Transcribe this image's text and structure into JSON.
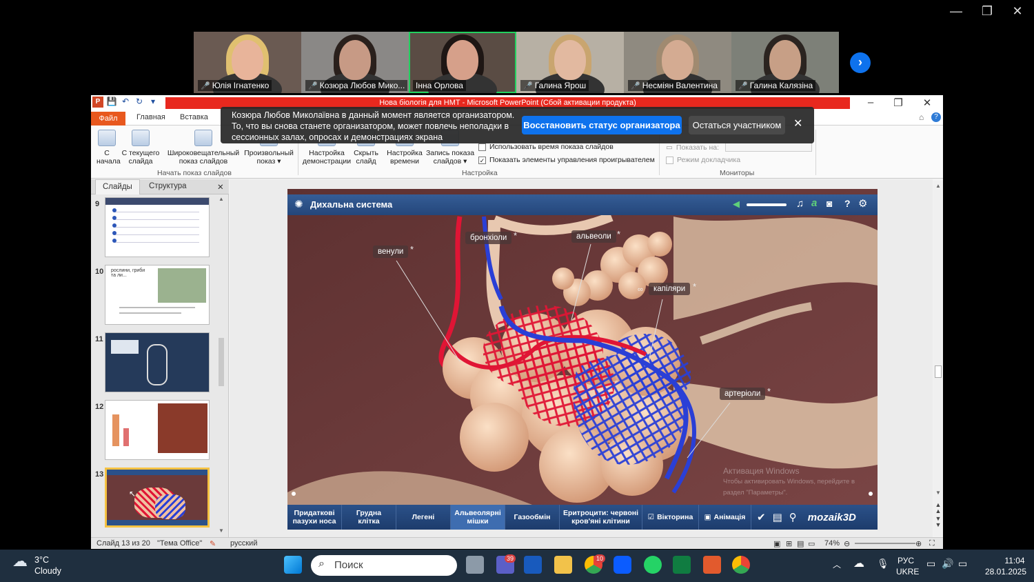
{
  "window": {
    "minimize": "—",
    "restore": "❐",
    "close": "✕"
  },
  "gallery": {
    "participants": [
      {
        "name": "Юлія Ігнатенко",
        "muted": true,
        "active": false,
        "bg": "#6a5a52",
        "face": "#e8b49a",
        "hair": "#e0c070"
      },
      {
        "name": "Козюра Любов Мико...",
        "muted": true,
        "active": false,
        "bg": "#8a8886",
        "face": "#c79a85",
        "hair": "#2a201c"
      },
      {
        "name": "Інна Орлова",
        "muted": false,
        "active": true,
        "bg": "#5a4c44",
        "face": "#d6a08a",
        "hair": "#1e1614"
      },
      {
        "name": "Галина Ярош",
        "muted": true,
        "active": false,
        "bg": "#b7b0a4",
        "face": "#e2b9a0",
        "hair": "#c9a56f"
      },
      {
        "name": "Несміян Валентина",
        "muted": true,
        "active": false,
        "bg": "#8f8a80",
        "face": "#d4ab92",
        "hair": "#a08a70"
      },
      {
        "name": "Галина Калязіна",
        "muted": true,
        "active": false,
        "bg": "#7d8078",
        "face": "#c79f86",
        "hair": "#2b2420"
      }
    ],
    "next_icon": "chevron-right-icon"
  },
  "ppt": {
    "title": "Нова біологія для НМТ - Microsoft PowerPoint (Сбой активации продукта)",
    "tabs": {
      "file": "Файл",
      "home": "Главная",
      "insert": "Вставка"
    },
    "ribbon": {
      "from_start": "С\nначала",
      "from_current": "С текущего\nслайда",
      "broadcast": "Широковещательный\nпоказ слайдов",
      "custom": "Произвольный\nпоказ ▾",
      "group_start": "Начать показ слайдов",
      "setup": "Настройка\nдемонстрации",
      "hide": "Скрыть\nслайд",
      "timing": "Настройка\nвремени",
      "record": "Запись показа\nслайдов ▾",
      "use_timings": "Использовать время показа слайдов",
      "show_controls": "Показать элементы управления проигрывателем",
      "group_setup": "Настройка",
      "show_on": "Показать на:",
      "presenter_view": "Режим докладчика",
      "group_monitors": "Мониторы"
    },
    "left_pane": {
      "tab_slides": "Слайды",
      "tab_outline": "Структура",
      "close": "✕",
      "thumbs": [
        {
          "num": "9"
        },
        {
          "num": "10"
        },
        {
          "num": "11"
        },
        {
          "num": "12"
        },
        {
          "num": "13"
        }
      ],
      "thumb10_text": "рослини, гриби\nта ли..."
    },
    "slide": {
      "app_title": "Дихальна система",
      "labels": {
        "venules": "венули",
        "bronchioles": "бронхіоли",
        "alveoli": "альвеоли",
        "capillaries": "капіляри",
        "arterioles": "артеріоли"
      },
      "footer": [
        {
          "label": "Придаткові\nпазухи носа",
          "on": false
        },
        {
          "label": "Грудна\nклітка",
          "on": false
        },
        {
          "label": "Легені",
          "on": false
        },
        {
          "label": "Альвеолярні\nмішки",
          "on": true
        },
        {
          "label": "Газообмін",
          "on": false
        },
        {
          "label": "Еритроцити: червоні\nкров'яні клітини",
          "on": false
        },
        {
          "label": "Вікторина",
          "on": false
        },
        {
          "label": "Анімація",
          "on": false
        }
      ],
      "brand": "mozaik3D",
      "watermark_title": "Активация Windows",
      "watermark_sub": "Чтобы активировать Windows, перейдите в\nраздел \"Параметры\"."
    },
    "status": {
      "slide": "Слайд 13 из 20",
      "theme": "\"Тема Office\"",
      "lang": "русский",
      "zoom": "74%"
    }
  },
  "notice": {
    "text": "Козюра Любов Миколаївна в данный момент является организатором.\nТо, что вы снова станете организатором, может повлечь неполадки в\nсессионных залах, опросах и демонстрациях экрана",
    "reclaim": "Восстановить статус организатора",
    "stay": "Остаться участником",
    "close": "✕"
  },
  "taskbar": {
    "weather_temp": "3°C",
    "weather_desc": "Cloudy",
    "search": "Поиск",
    "badge_teams": "39",
    "badge_chrome": "10",
    "lang1": "РУС",
    "lang2": "UKRE",
    "time": "11:04",
    "date": "28.01.2025"
  }
}
